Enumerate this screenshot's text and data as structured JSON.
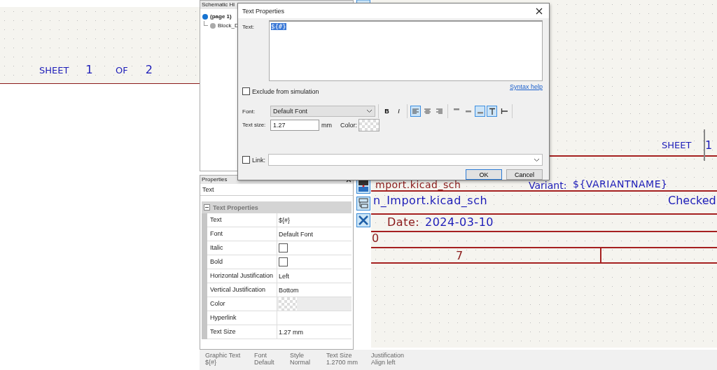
{
  "left_canvas": {
    "sheet_label": "SHEET",
    "sheet_number": "1",
    "of_label": "OF",
    "sheet_count": "2"
  },
  "hierarchy_panel": {
    "title": "Schematic Hi",
    "items": [
      {
        "label": "(page 1)",
        "selected": true,
        "children": [
          {
            "label": "Block_D",
            "selected": false
          }
        ]
      }
    ]
  },
  "title_block": {
    "file_name": "mport.kicad_sch",
    "variant_label": "Variant:",
    "variant_value": "${VARIANTNAME}",
    "sheet_label": "SHEET",
    "sheet_number": "1",
    "file_path": "n_Import.kicad_sch",
    "checked_label": "Checked",
    "date_label": "Date:",
    "date_value": "2024-03-10",
    "revision": "0",
    "cell": "7"
  },
  "dialog": {
    "title": "Text Properties",
    "text_label": "Text:",
    "text_value": "${#}",
    "text_selected": true,
    "exclude": {
      "label": "Exclude from simulation",
      "checked": false
    },
    "syntax_help": "Syntax help",
    "font_label": "Font:",
    "font_value": "Default Font",
    "style_buttons": [
      {
        "label": "B",
        "kind": "bold",
        "selected": false
      },
      {
        "label": "I",
        "kind": "italic",
        "selected": false
      }
    ],
    "h_align": [
      {
        "kind": "left",
        "selected": true
      },
      {
        "kind": "center",
        "selected": false
      },
      {
        "kind": "right",
        "selected": false
      }
    ],
    "v_align": [
      {
        "kind": "top",
        "selected": false
      },
      {
        "kind": "middle",
        "selected": false
      },
      {
        "kind": "bottom",
        "selected": true
      }
    ],
    "orientation": [
      {
        "kind": "horizontal",
        "selected": true
      },
      {
        "kind": "vertical",
        "selected": false
      }
    ],
    "size_label": "Text size:",
    "size_value": "1.27",
    "size_unit": "mm",
    "color_label": "Color:",
    "link": {
      "label": "Link:",
      "checked": false
    },
    "buttons": [
      {
        "label": "OK",
        "default": true
      },
      {
        "label": "Cancel",
        "default": false
      }
    ]
  },
  "properties_panel": {
    "title": "Properties",
    "subject": "Text",
    "group": {
      "title": "Text Properties",
      "expanded": true,
      "rows": [
        {
          "kind": "text",
          "name": "Text",
          "value": "${#}"
        },
        {
          "kind": "text",
          "name": "Font",
          "value": "Default Font"
        },
        {
          "kind": "checkbox",
          "name": "Italic",
          "checked": false
        },
        {
          "kind": "checkbox",
          "name": "Bold",
          "checked": false
        },
        {
          "kind": "text",
          "name": "Horizontal Justification",
          "value": "Left"
        },
        {
          "kind": "text",
          "name": "Vertical Justification",
          "value": "Bottom"
        },
        {
          "kind": "color",
          "name": "Color"
        },
        {
          "kind": "text",
          "name": "Hyperlink"
        },
        {
          "kind": "text",
          "name": "Text Size",
          "value": "1.27 mm"
        }
      ]
    }
  },
  "status_bar": [
    {
      "label": "Graphic Text",
      "value": "${#}"
    },
    {
      "label": "Font",
      "value": "Default"
    },
    {
      "label": "Style",
      "value": "Normal"
    },
    {
      "label": "Text Size",
      "value": "1.2700 mm"
    },
    {
      "label": "Justification",
      "value": "Align left"
    }
  ]
}
